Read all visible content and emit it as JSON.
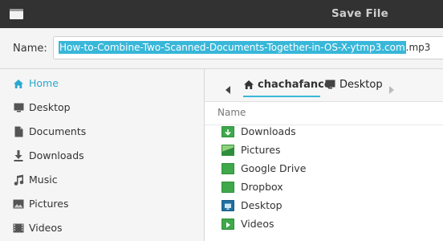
{
  "window": {
    "title": "Save File"
  },
  "name_field": {
    "label": "Name:",
    "value_selected": "How-to-Combine-Two-Scanned-Documents-Together-in-OS-X-ytmp3.com",
    "value_extension": ".mp3",
    "selection_color": "#38b7d9"
  },
  "sidebar": {
    "items": [
      {
        "label": "Home",
        "icon": "home-icon",
        "active": true
      },
      {
        "label": "Desktop",
        "icon": "desktop-icon"
      },
      {
        "label": "Documents",
        "icon": "document-icon"
      },
      {
        "label": "Downloads",
        "icon": "download-icon"
      },
      {
        "label": "Music",
        "icon": "music-icon"
      },
      {
        "label": "Pictures",
        "icon": "picture-icon"
      },
      {
        "label": "Videos",
        "icon": "video-icon"
      }
    ]
  },
  "pathbar": {
    "crumbs": [
      {
        "label": "chachafance",
        "icon": "home-icon",
        "active": true
      },
      {
        "label": "Desktop",
        "icon": "desktop-icon"
      }
    ]
  },
  "files": {
    "column_name": "Name",
    "rows": [
      {
        "label": "Downloads",
        "icon": "downloads-folder-icon"
      },
      {
        "label": "Pictures",
        "icon": "pictures-folder-icon"
      },
      {
        "label": "Google Drive",
        "icon": "folder-icon"
      },
      {
        "label": "Dropbox",
        "icon": "folder-icon"
      },
      {
        "label": "Desktop",
        "icon": "desktop-folder-icon"
      },
      {
        "label": "Videos",
        "icon": "videos-folder-icon"
      }
    ]
  },
  "colors": {
    "titlebar": "#323232",
    "accent": "#2aa7cf"
  }
}
